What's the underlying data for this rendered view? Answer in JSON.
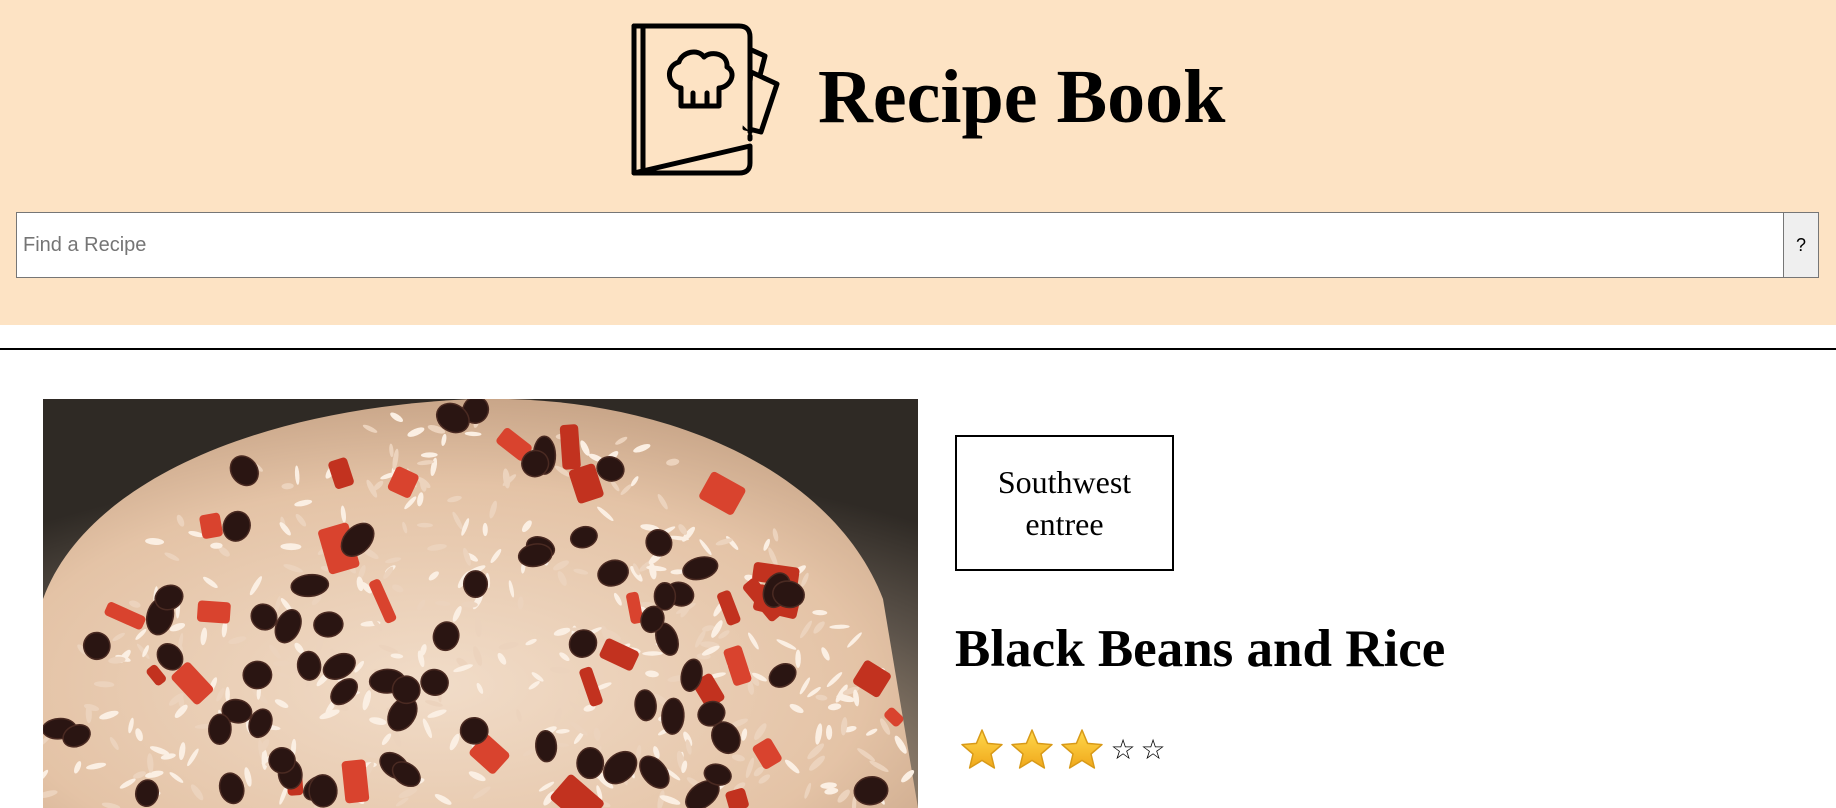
{
  "header": {
    "title": "Recipe Book",
    "logo_icon": "recipe-book-chef-hat-icon",
    "background_color": "#fde3c4"
  },
  "search": {
    "placeholder": "Find a Recipe",
    "value": "",
    "button_label": "?"
  },
  "recipe": {
    "category": "Southwest entree",
    "title": "Black Beans and Rice",
    "image_alt": "Black beans and rice",
    "rating": {
      "value": 3,
      "max": 5,
      "filled_icon": "gold-star-icon",
      "empty_icon": "outline-star-icon",
      "empty_glyph": "☆"
    }
  }
}
